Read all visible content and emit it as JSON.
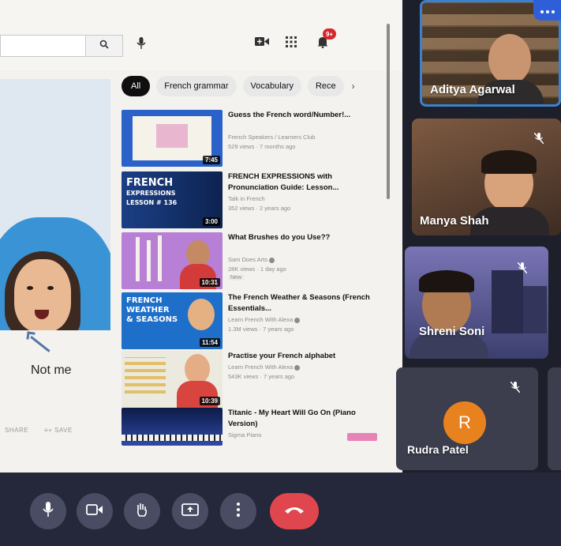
{
  "colors": {
    "accent": "#2f5fd8",
    "hangup": "#e0464d",
    "avatar_bg": "#e8821f",
    "notification": "#d8262b"
  },
  "youtube": {
    "notification_count": "9+",
    "player_caption": "Not me",
    "actions": [
      {
        "label": "SHARE",
        "icon": "share-icon"
      },
      {
        "label": "SAVE",
        "icon": "save-icon"
      }
    ],
    "chips": [
      "All",
      "French grammar",
      "Vocabulary",
      "Rece"
    ],
    "recommended": [
      {
        "title": "Guess the French word/Number!...",
        "channel": "French Speakers / Learners Club",
        "meta": "529 views · 7 months ago",
        "duration": "7:45",
        "badge": ""
      },
      {
        "title": "FRENCH EXPRESSIONS with Pronunciation Guide: Lesson...",
        "channel": "Talk in French",
        "meta": "352 views · 2 years ago",
        "duration": "3:00",
        "badge": "",
        "thumb_text": [
          "FRENCH",
          "EXPRESSIONS",
          "LESSON # 136"
        ]
      },
      {
        "title": "What Brushes do you Use??",
        "channel": "Sam Does Arts",
        "meta": "28K views · 1 day ago",
        "duration": "10:31",
        "badge": "New"
      },
      {
        "title": "The French Weather & Seasons (French Essentials...",
        "channel": "Learn French With Alexa",
        "meta": "1.3M views · 7 years ago",
        "duration": "11:54",
        "badge": "",
        "thumb_text": [
          "FRENCH",
          "WEATHER",
          "& SEASONS"
        ]
      },
      {
        "title": "Practise your French alphabet",
        "channel": "Learn French With Alexa",
        "meta": "543K views · 7 years ago",
        "duration": "10:39",
        "badge": ""
      },
      {
        "title": "Titanic - My Heart Will Go On (Piano Version)",
        "channel": "Sigma Piano",
        "meta": "",
        "duration": "",
        "badge": ""
      }
    ]
  },
  "participants": [
    {
      "name": "Aditya Agarwal"
    },
    {
      "name": "Manya Shah"
    },
    {
      "name": "Shreni Soni"
    },
    {
      "name": "Rudra Patel",
      "initial": "R"
    }
  ],
  "controls": [
    "microphone-icon",
    "camera-icon",
    "raise-hand-icon",
    "present-icon",
    "more-options-icon",
    "hang-up-icon"
  ]
}
